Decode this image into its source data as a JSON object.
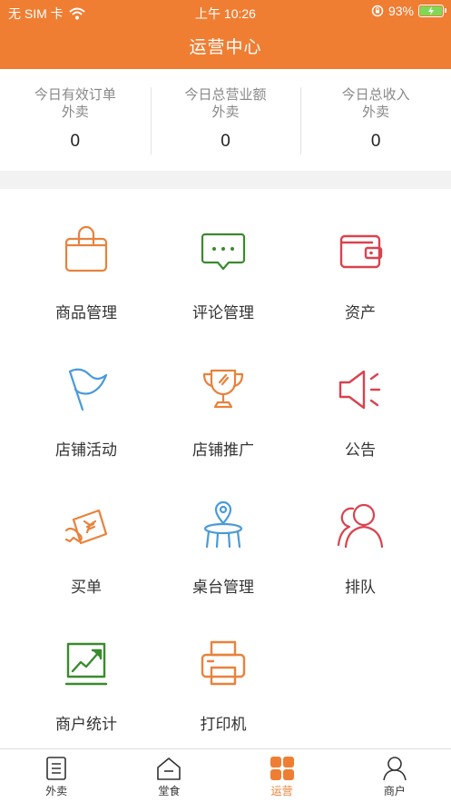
{
  "status_bar": {
    "carrier": "无 SIM 卡",
    "time": "上午 10:26",
    "battery": "93%"
  },
  "header": {
    "title": "运营中心"
  },
  "stats": [
    {
      "label": "今日有效订单",
      "sub": "外卖",
      "value": "0"
    },
    {
      "label": "今日总营业额",
      "sub": "外卖",
      "value": "0"
    },
    {
      "label": "今日总收入",
      "sub": "外卖",
      "value": "0"
    }
  ],
  "grid": [
    {
      "label": "商品管理",
      "icon": "shopping-bag-icon",
      "color": "#e8823c"
    },
    {
      "label": "评论管理",
      "icon": "comment-icon",
      "color": "#3a8a2e"
    },
    {
      "label": "资产",
      "icon": "wallet-icon",
      "color": "#d9434f"
    },
    {
      "label": "店铺活动",
      "icon": "flag-icon",
      "color": "#4a9ad8"
    },
    {
      "label": "店铺推广",
      "icon": "trophy-icon",
      "color": "#e8823c"
    },
    {
      "label": "公告",
      "icon": "megaphone-icon",
      "color": "#d9434f"
    },
    {
      "label": "买单",
      "icon": "coupon-hand-icon",
      "color": "#e8823c"
    },
    {
      "label": "桌台管理",
      "icon": "table-icon",
      "color": "#4a9ad8"
    },
    {
      "label": "排队",
      "icon": "queue-users-icon",
      "color": "#d9434f"
    },
    {
      "label": "商户统计",
      "icon": "chart-icon",
      "color": "#3a8a2e"
    },
    {
      "label": "打印机",
      "icon": "printer-icon",
      "color": "#e8823c"
    }
  ],
  "tabbar": {
    "active_color": "#ef7e33",
    "items": [
      {
        "label": "外卖",
        "icon": "list-icon",
        "active": false
      },
      {
        "label": "堂食",
        "icon": "home-icon",
        "active": false
      },
      {
        "label": "运营",
        "icon": "grid-icon",
        "active": true
      },
      {
        "label": "商户",
        "icon": "user-icon",
        "active": false
      }
    ]
  }
}
